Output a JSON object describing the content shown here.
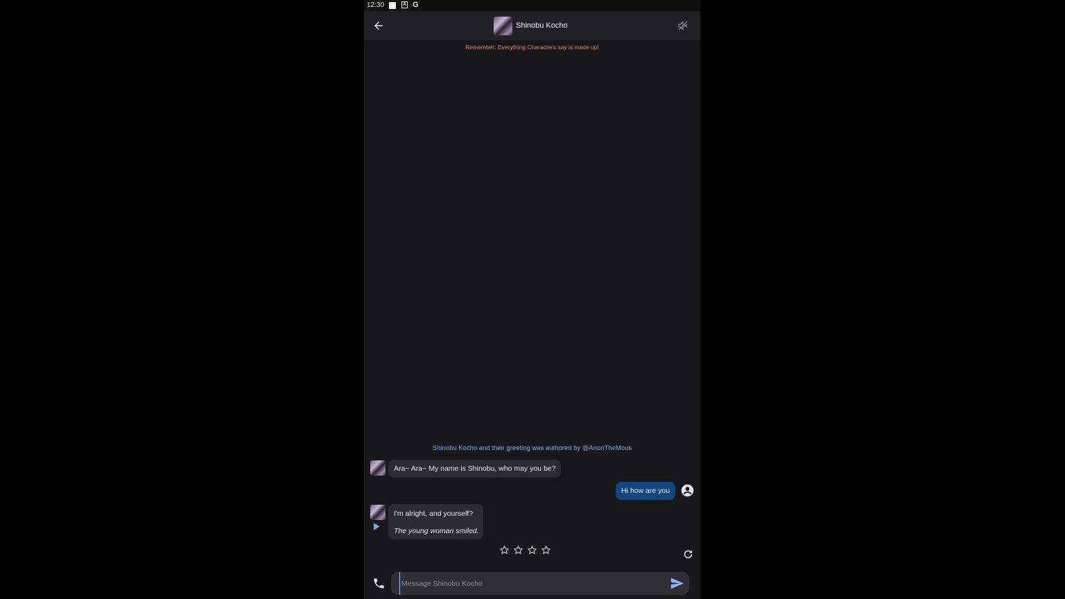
{
  "status_bar": {
    "time": "12:30",
    "icons": [
      "square-notification-icon",
      "a-notification-icon",
      "google-icon"
    ]
  },
  "header": {
    "title": "Shinobu Kocho",
    "back_icon": "arrow-left-icon",
    "mute_icon": "volume-off-icon"
  },
  "disclaimer": "Remember: Everything Characters say is made up!",
  "author_note": "Shinobu Kocho and their greeting was authored by @AnonTheMous",
  "messages": [
    {
      "sender": "character",
      "text": "Ara~ Ara~ My name is Shinobu, who may you be?"
    },
    {
      "sender": "user",
      "text": "Hi how are you"
    },
    {
      "sender": "character",
      "text": "I'm alright, and yourself?",
      "action": "The young woman smiled."
    }
  ],
  "rating": {
    "stars": 4,
    "filled": 0
  },
  "composer": {
    "placeholder": "Message Shinobu Kocho",
    "value": ""
  },
  "colors": {
    "background": "#18181b",
    "header": "#212125",
    "user_bubble": "#10467d",
    "bubble": "#2b2b30",
    "disclaimer": "#e27b6a",
    "author": "#7fa8e0",
    "send": "#8fb4ff"
  }
}
